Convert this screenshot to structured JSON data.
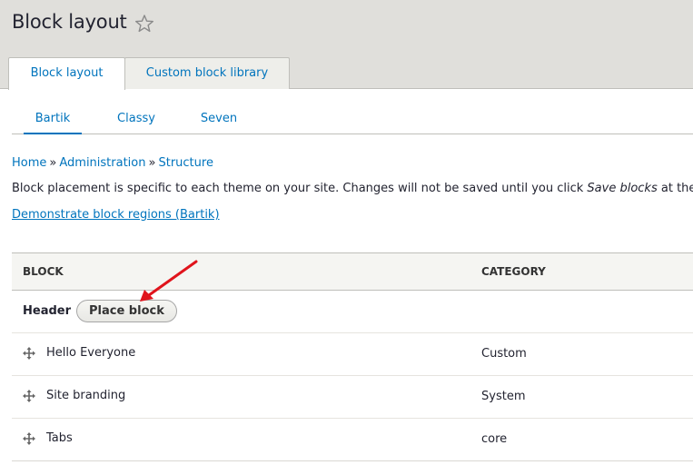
{
  "page": {
    "title": "Block layout"
  },
  "primary_tabs": [
    {
      "label": "Block layout",
      "active": true
    },
    {
      "label": "Custom block library",
      "active": false
    }
  ],
  "secondary_tabs": [
    {
      "label": "Bartik",
      "active": true
    },
    {
      "label": "Classy",
      "active": false
    },
    {
      "label": "Seven",
      "active": false
    }
  ],
  "breadcrumb": {
    "items": [
      "Home",
      "Administration",
      "Structure"
    ],
    "separator": "»"
  },
  "help": {
    "text_before": "Block placement is specific to each theme on your site. Changes will not be saved until you click ",
    "emphasis": "Save blocks",
    "text_after": " at the bot"
  },
  "demo_link": "Demonstrate block regions (Bartik)",
  "table": {
    "headers": {
      "block": "BLOCK",
      "category": "CATEGORY"
    },
    "region": {
      "name": "Header",
      "place_block_label": "Place block"
    },
    "rows": [
      {
        "block": "Hello Everyone",
        "category": "Custom"
      },
      {
        "block": "Site branding",
        "category": "System"
      },
      {
        "block": "Tabs",
        "category": "core"
      }
    ]
  },
  "icons": {
    "favorite": "star-outline-icon",
    "drag": "move-cross-icon",
    "annotation": "red-arrow-icon"
  },
  "colors": {
    "link": "#0074bd",
    "header_bg": "#e0dfdb",
    "annotation": "#e0141c"
  }
}
